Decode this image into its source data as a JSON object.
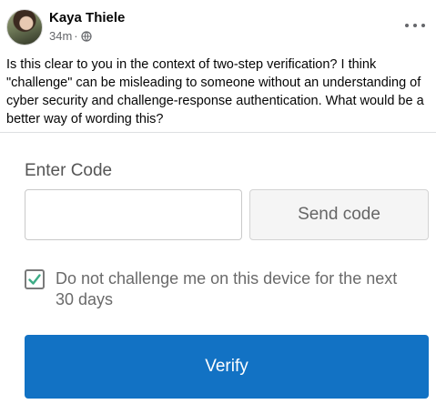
{
  "post": {
    "author": "Kaya Thiele",
    "time": "34m",
    "separator": "·",
    "audience_icon": "globe-icon",
    "more_icon": "more-options-icon",
    "text": "Is this clear to you in the context of two-step verification? I think \"challenge\" can be misleading to someone without an understanding of cyber security and challenge-response authentication. What would be a better way of wording this?"
  },
  "form": {
    "label": "Enter Code",
    "code_value": "",
    "send_code_label": "Send code",
    "checkbox_checked": true,
    "checkbox_label": "Do not challenge me on this device for the next 30 days",
    "verify_label": "Verify",
    "colors": {
      "primary": "#1272c4",
      "check": "#3dac86"
    }
  }
}
